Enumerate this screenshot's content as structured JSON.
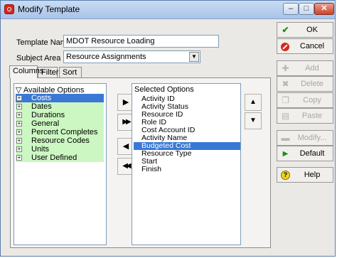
{
  "window": {
    "title": "Modify Template",
    "controls": {
      "minimize": "–",
      "maximize": "□",
      "close": "✕"
    }
  },
  "form": {
    "template_name_label": "Template Name",
    "template_name_value": "MDOT Resource Loading",
    "subject_area_label": "Subject Area",
    "subject_area_value": "Resource Assignments"
  },
  "tabs": [
    {
      "label": "Columns",
      "active": true
    },
    {
      "label": "Filter",
      "active": false
    },
    {
      "label": "Sort",
      "active": false
    }
  ],
  "available": {
    "header": "Available Options",
    "items": [
      {
        "label": "Costs",
        "selected": true
      },
      {
        "label": "Dates",
        "selected": false
      },
      {
        "label": "Durations",
        "selected": false
      },
      {
        "label": "General",
        "selected": false
      },
      {
        "label": "Percent Completes",
        "selected": false
      },
      {
        "label": "Resource Codes",
        "selected": false
      },
      {
        "label": "Units",
        "selected": false
      },
      {
        "label": "User Defined",
        "selected": false
      }
    ]
  },
  "selected": {
    "header": "Selected Options",
    "items": [
      {
        "label": "Activity ID",
        "selected": false
      },
      {
        "label": "Activity Status",
        "selected": false
      },
      {
        "label": "Resource ID",
        "selected": false
      },
      {
        "label": "Role ID",
        "selected": false
      },
      {
        "label": "Cost Account ID",
        "selected": false
      },
      {
        "label": "Activity Name",
        "selected": false
      },
      {
        "label": "Budgeted Cost",
        "selected": true
      },
      {
        "label": "Resource Type",
        "selected": false
      },
      {
        "label": "Start",
        "selected": false
      },
      {
        "label": "Finish",
        "selected": false
      }
    ]
  },
  "move_buttons": {
    "add": "▶",
    "add_all": "▶▶",
    "remove": "◀",
    "remove_all": "◀◀"
  },
  "order_buttons": {
    "up": "▲",
    "down": "▼"
  },
  "sidebar": {
    "ok": "OK",
    "cancel": "Cancel",
    "add": "Add",
    "delete": "Delete",
    "copy": "Copy",
    "paste": "Paste",
    "modify": "Modify...",
    "default": "Default",
    "help": "Help"
  },
  "colors": {
    "title_gradient": "#b6cdee",
    "available_row_bg": "#ccf7c2",
    "selection": "#3a78d6",
    "ok_green": "#1c8c1c",
    "cancel_red": "#d7261d"
  }
}
